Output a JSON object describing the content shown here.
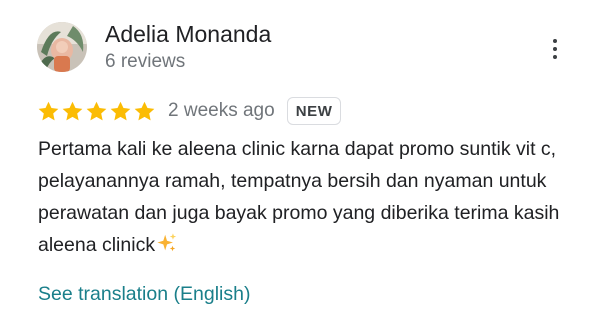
{
  "reviewer": {
    "name": "Adelia Monanda",
    "review_count": "6 reviews",
    "avatar_icon": "profile-photo"
  },
  "menu": {
    "icon": "more-vert-icon"
  },
  "rating": {
    "stars": 5,
    "max_stars": 5,
    "star_color": "#fbbc04",
    "date": "2 weeks ago",
    "badge": "NEW"
  },
  "review": {
    "text": "Pertama kali ke aleena clinic karna dapat promo suntik vit c, pelayanannya ramah, tempatnya bersih dan nyaman untuk perawatan dan juga bayak promo yang diberika terima kasih aleena clinick",
    "emoji_icon": "sparkles-icon"
  },
  "translation": {
    "link_label": "See translation (English)",
    "link_color": "#1a7f8a"
  }
}
